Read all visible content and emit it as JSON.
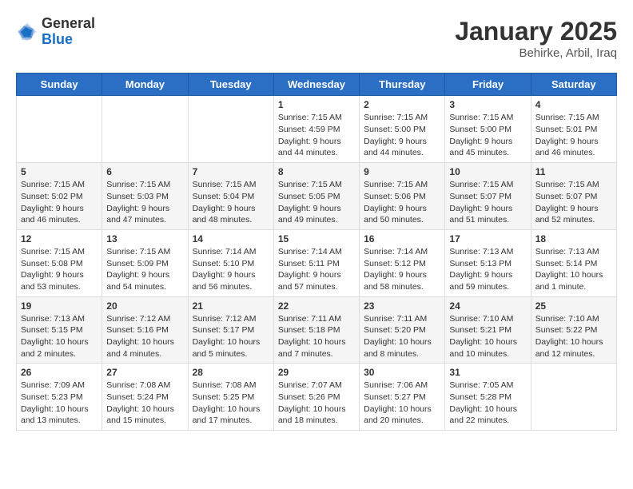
{
  "header": {
    "logo_general": "General",
    "logo_blue": "Blue",
    "title": "January 2025",
    "subtitle": "Behirke, Arbil, Iraq"
  },
  "days_of_week": [
    "Sunday",
    "Monday",
    "Tuesday",
    "Wednesday",
    "Thursday",
    "Friday",
    "Saturday"
  ],
  "weeks": [
    [
      {
        "day": "",
        "info": ""
      },
      {
        "day": "",
        "info": ""
      },
      {
        "day": "",
        "info": ""
      },
      {
        "day": "1",
        "info": "Sunrise: 7:15 AM\nSunset: 4:59 PM\nDaylight: 9 hours\nand 44 minutes."
      },
      {
        "day": "2",
        "info": "Sunrise: 7:15 AM\nSunset: 5:00 PM\nDaylight: 9 hours\nand 44 minutes."
      },
      {
        "day": "3",
        "info": "Sunrise: 7:15 AM\nSunset: 5:00 PM\nDaylight: 9 hours\nand 45 minutes."
      },
      {
        "day": "4",
        "info": "Sunrise: 7:15 AM\nSunset: 5:01 PM\nDaylight: 9 hours\nand 46 minutes."
      }
    ],
    [
      {
        "day": "5",
        "info": "Sunrise: 7:15 AM\nSunset: 5:02 PM\nDaylight: 9 hours\nand 46 minutes."
      },
      {
        "day": "6",
        "info": "Sunrise: 7:15 AM\nSunset: 5:03 PM\nDaylight: 9 hours\nand 47 minutes."
      },
      {
        "day": "7",
        "info": "Sunrise: 7:15 AM\nSunset: 5:04 PM\nDaylight: 9 hours\nand 48 minutes."
      },
      {
        "day": "8",
        "info": "Sunrise: 7:15 AM\nSunset: 5:05 PM\nDaylight: 9 hours\nand 49 minutes."
      },
      {
        "day": "9",
        "info": "Sunrise: 7:15 AM\nSunset: 5:06 PM\nDaylight: 9 hours\nand 50 minutes."
      },
      {
        "day": "10",
        "info": "Sunrise: 7:15 AM\nSunset: 5:07 PM\nDaylight: 9 hours\nand 51 minutes."
      },
      {
        "day": "11",
        "info": "Sunrise: 7:15 AM\nSunset: 5:07 PM\nDaylight: 9 hours\nand 52 minutes."
      }
    ],
    [
      {
        "day": "12",
        "info": "Sunrise: 7:15 AM\nSunset: 5:08 PM\nDaylight: 9 hours\nand 53 minutes."
      },
      {
        "day": "13",
        "info": "Sunrise: 7:15 AM\nSunset: 5:09 PM\nDaylight: 9 hours\nand 54 minutes."
      },
      {
        "day": "14",
        "info": "Sunrise: 7:14 AM\nSunset: 5:10 PM\nDaylight: 9 hours\nand 56 minutes."
      },
      {
        "day": "15",
        "info": "Sunrise: 7:14 AM\nSunset: 5:11 PM\nDaylight: 9 hours\nand 57 minutes."
      },
      {
        "day": "16",
        "info": "Sunrise: 7:14 AM\nSunset: 5:12 PM\nDaylight: 9 hours\nand 58 minutes."
      },
      {
        "day": "17",
        "info": "Sunrise: 7:13 AM\nSunset: 5:13 PM\nDaylight: 9 hours\nand 59 minutes."
      },
      {
        "day": "18",
        "info": "Sunrise: 7:13 AM\nSunset: 5:14 PM\nDaylight: 10 hours\nand 1 minute."
      }
    ],
    [
      {
        "day": "19",
        "info": "Sunrise: 7:13 AM\nSunset: 5:15 PM\nDaylight: 10 hours\nand 2 minutes."
      },
      {
        "day": "20",
        "info": "Sunrise: 7:12 AM\nSunset: 5:16 PM\nDaylight: 10 hours\nand 4 minutes."
      },
      {
        "day": "21",
        "info": "Sunrise: 7:12 AM\nSunset: 5:17 PM\nDaylight: 10 hours\nand 5 minutes."
      },
      {
        "day": "22",
        "info": "Sunrise: 7:11 AM\nSunset: 5:18 PM\nDaylight: 10 hours\nand 7 minutes."
      },
      {
        "day": "23",
        "info": "Sunrise: 7:11 AM\nSunset: 5:20 PM\nDaylight: 10 hours\nand 8 minutes."
      },
      {
        "day": "24",
        "info": "Sunrise: 7:10 AM\nSunset: 5:21 PM\nDaylight: 10 hours\nand 10 minutes."
      },
      {
        "day": "25",
        "info": "Sunrise: 7:10 AM\nSunset: 5:22 PM\nDaylight: 10 hours\nand 12 minutes."
      }
    ],
    [
      {
        "day": "26",
        "info": "Sunrise: 7:09 AM\nSunset: 5:23 PM\nDaylight: 10 hours\nand 13 minutes."
      },
      {
        "day": "27",
        "info": "Sunrise: 7:08 AM\nSunset: 5:24 PM\nDaylight: 10 hours\nand 15 minutes."
      },
      {
        "day": "28",
        "info": "Sunrise: 7:08 AM\nSunset: 5:25 PM\nDaylight: 10 hours\nand 17 minutes."
      },
      {
        "day": "29",
        "info": "Sunrise: 7:07 AM\nSunset: 5:26 PM\nDaylight: 10 hours\nand 18 minutes."
      },
      {
        "day": "30",
        "info": "Sunrise: 7:06 AM\nSunset: 5:27 PM\nDaylight: 10 hours\nand 20 minutes."
      },
      {
        "day": "31",
        "info": "Sunrise: 7:05 AM\nSunset: 5:28 PM\nDaylight: 10 hours\nand 22 minutes."
      },
      {
        "day": "",
        "info": ""
      }
    ]
  ]
}
